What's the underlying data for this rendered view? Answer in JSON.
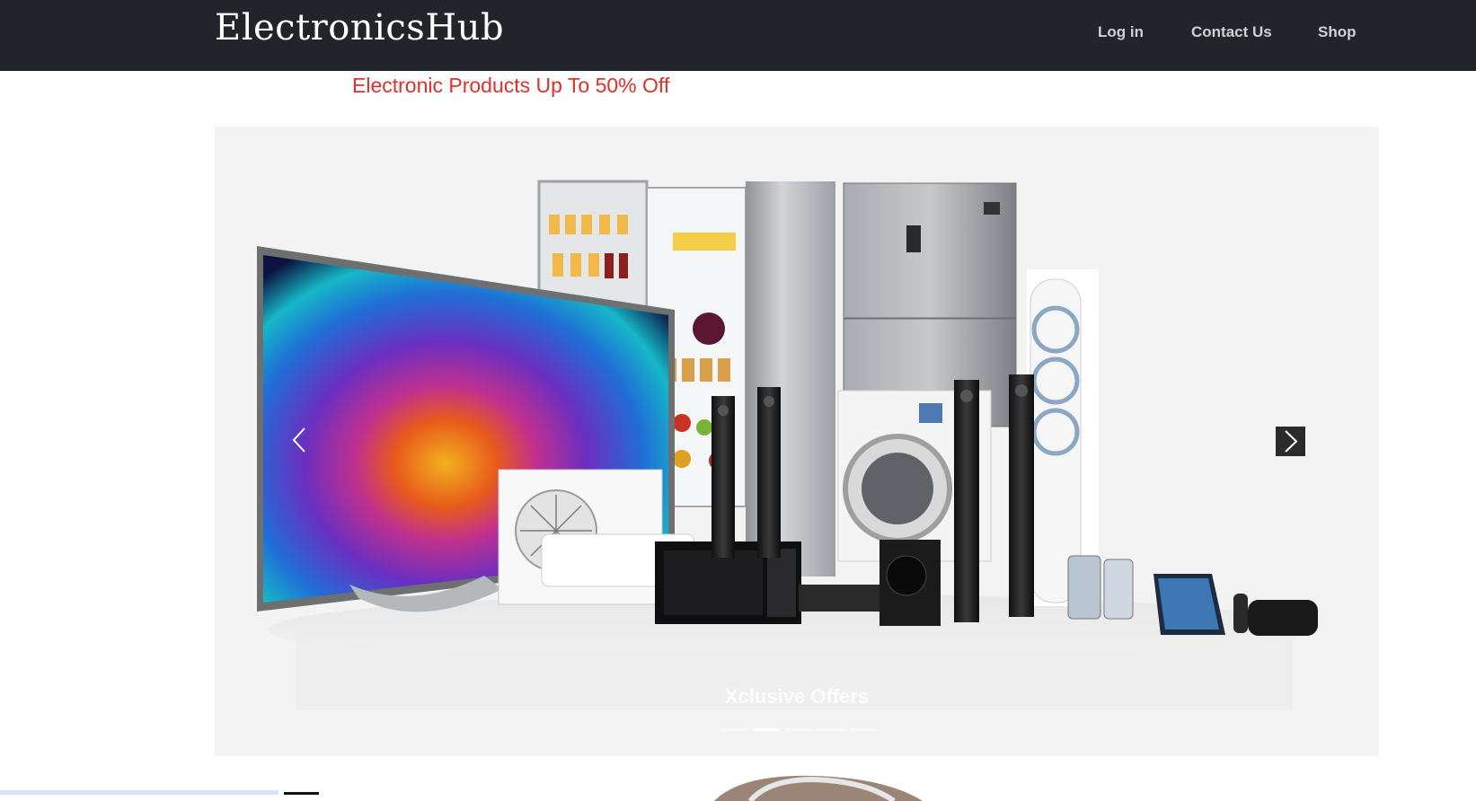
{
  "navbar": {
    "brand": "ElectronicsHub",
    "links": [
      {
        "label": "Log in"
      },
      {
        "label": "Contact Us"
      },
      {
        "label": "Shop"
      }
    ],
    "background": "#212529"
  },
  "promo": {
    "text": "Electronic Products Up To 50% Off",
    "color": "#e0302a"
  },
  "carousel": {
    "caption": "Xclusive Offers",
    "active_slide": 2,
    "slide_count": 5,
    "prev_icon": "chevron-left-icon",
    "next_icon": "chevron-right-icon",
    "slide_image": "electronics-appliances-collage"
  }
}
